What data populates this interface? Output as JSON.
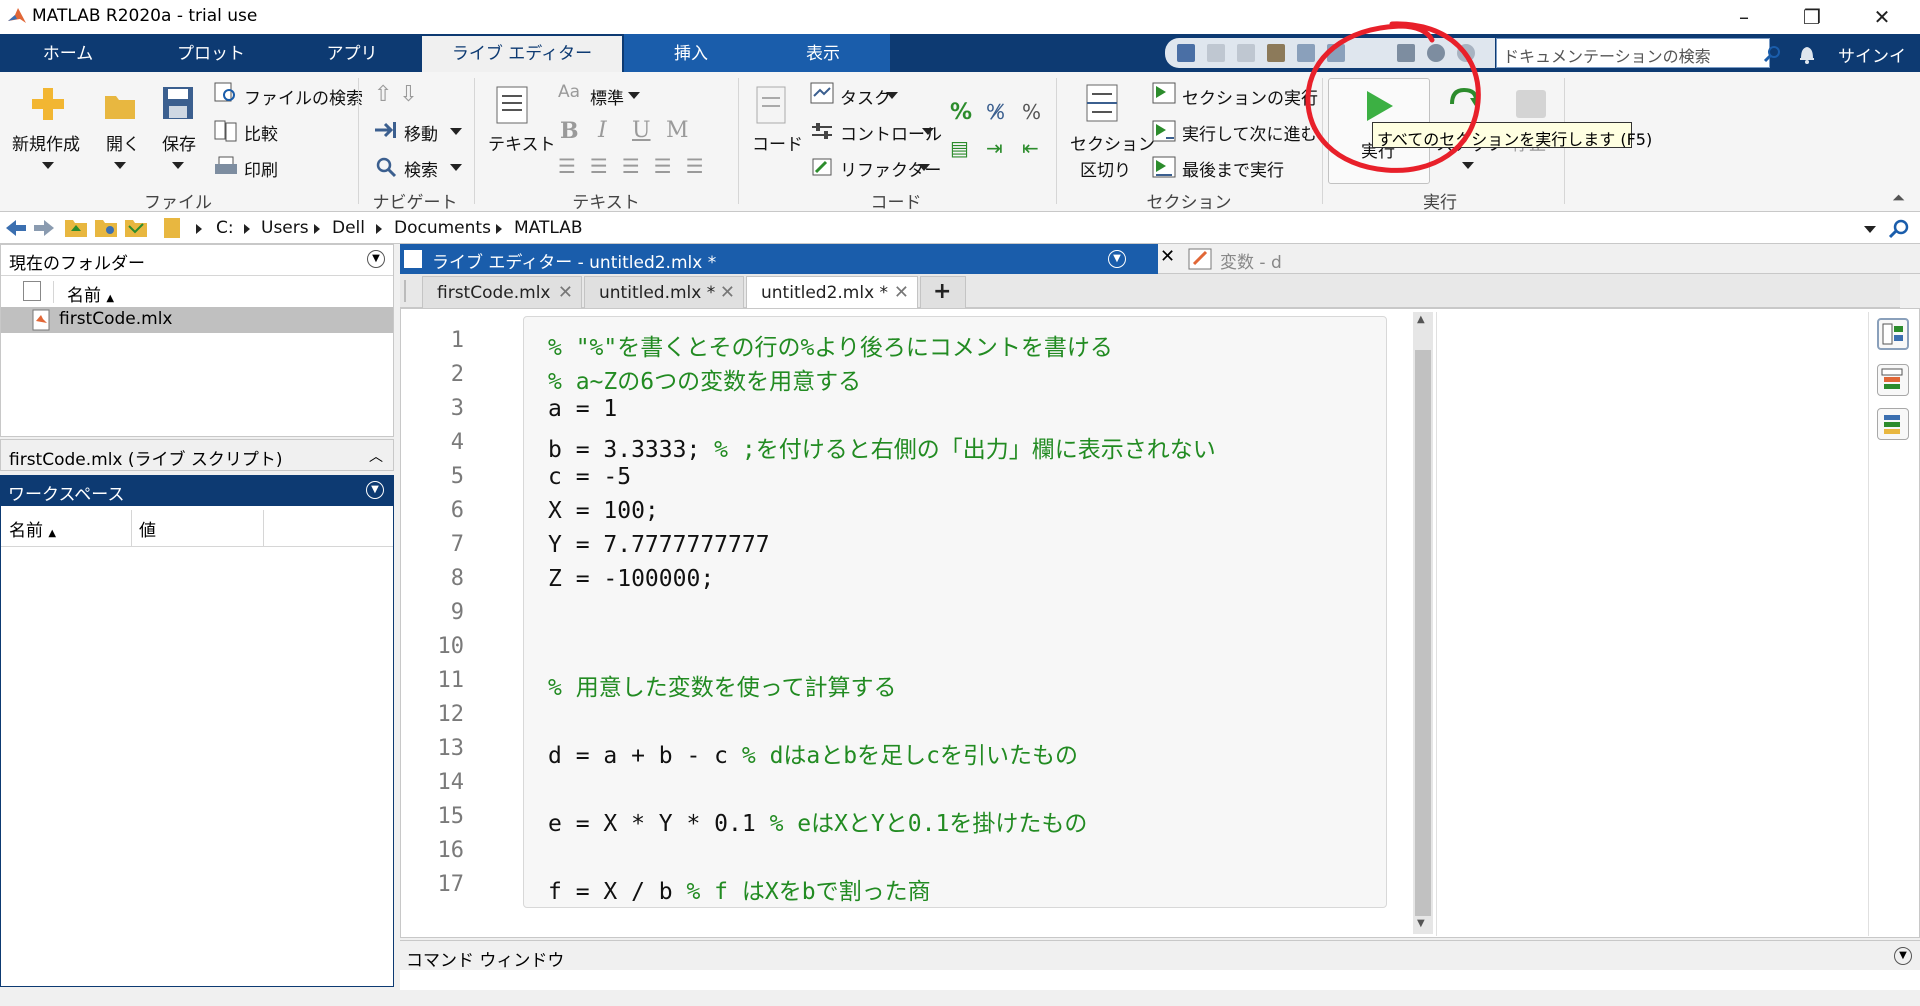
{
  "window": {
    "title": "MATLAB R2020a - trial use"
  },
  "ribbon_tabs": [
    "ホーム",
    "プロット",
    "アプリ",
    "ライブ エディター",
    "挿入",
    "表示"
  ],
  "doc_search": {
    "placeholder": "ドキュメンテーションの検索"
  },
  "signin_label": "サインイン",
  "ribbon": {
    "file": {
      "new_label": "新規作成",
      "open_label": "開く",
      "save_label": "保存",
      "find_files_label": "ファイルの検索",
      "compare_label": "比較",
      "print_label": "印刷",
      "group_label": "ファイル"
    },
    "navigate": {
      "goto_label": "移動",
      "find_label": "検索",
      "group_label": "ナビゲート"
    },
    "text": {
      "text_label": "テキスト",
      "style_label": "標準",
      "group_label": "テキスト"
    },
    "code": {
      "code_label": "コード",
      "task_label": "タスク",
      "control_label": "コントロール",
      "refactor_label": "リファクター",
      "group_label": "コード"
    },
    "section": {
      "break_label_1": "セクション",
      "break_label_2": "区切り",
      "run_section_label": "セクションの実行",
      "run_advance_label": "実行して次に進む",
      "run_to_end_label": "最後まで実行",
      "group_label": "セクション"
    },
    "run": {
      "run_label": "実行",
      "step_label": "ステップ",
      "stop_label": "停止",
      "group_label": "実行"
    }
  },
  "tooltip": "すべてのセクションを実行します (F5)",
  "address": {
    "parts": [
      "C:",
      "Users",
      "Dell",
      "Documents",
      "MATLAB"
    ]
  },
  "current_folder": {
    "title": "現在のフォルダー",
    "column_name": "名前",
    "files": [
      "firstCode.mlx"
    ],
    "details": "firstCode.mlx  (ライブ スクリプト)"
  },
  "workspace": {
    "title": "ワークスペース",
    "col_name": "名前",
    "col_value": "値"
  },
  "editor": {
    "title": "ライブ エディター - untitled2.mlx *",
    "variables_title": "変数 - d",
    "tabs": [
      "firstCode.mlx",
      "untitled.mlx *",
      "untitled2.mlx *"
    ],
    "add_tab": "+",
    "line_numbers": [
      "1",
      "2",
      "3",
      "4",
      "5",
      "6",
      "7",
      "8",
      "9",
      "10",
      "11",
      "12",
      "13",
      "14",
      "15",
      "16",
      "17"
    ],
    "lines": [
      {
        "code": "",
        "comment": "% \"%\"を書くとその行の%より後ろにコメントを書ける"
      },
      {
        "code": "",
        "comment": "% a~Zの6つの変数を用意する"
      },
      {
        "code": "a = 1",
        "comment": ""
      },
      {
        "code": "b = 3.3333; ",
        "comment": "% ;を付けると右側の「出力」欄に表示されない"
      },
      {
        "code": "c = -5",
        "comment": ""
      },
      {
        "code": "X = 100;",
        "comment": ""
      },
      {
        "code": "Y = 7.7777777777",
        "comment": ""
      },
      {
        "code": "Z = -100000;",
        "comment": ""
      },
      {
        "code": "",
        "comment": ""
      },
      {
        "code": "",
        "comment": ""
      },
      {
        "code": "",
        "comment": "% 用意した変数を使って計算する"
      },
      {
        "code": "",
        "comment": ""
      },
      {
        "code": "d = a + b - c ",
        "comment": "% dはaとbを足しcを引いたもの"
      },
      {
        "code": "",
        "comment": ""
      },
      {
        "code": "e = X * Y * 0.1 ",
        "comment": "% eはXとYと0.1を掛けたもの"
      },
      {
        "code": "",
        "comment": ""
      },
      {
        "code": "f = X / b ",
        "comment": "% f はXをbで割った商"
      }
    ]
  },
  "command_window": {
    "title": "コマンド ウィンドウ"
  },
  "colors": {
    "tab_bar": "#0d3a72",
    "editor_header": "#1a5dab",
    "comment": "#228b22",
    "annotation_circle": "#e8202a"
  },
  "icons": [
    "matlab-logo-icon",
    "new-icon",
    "open-folder-icon",
    "save-icon",
    "find-files-icon",
    "compare-icon",
    "print-icon",
    "run-icon",
    "step-icon",
    "stop-icon",
    "back-arrow-icon",
    "forward-arrow-icon",
    "search-icon",
    "bell-icon"
  ]
}
